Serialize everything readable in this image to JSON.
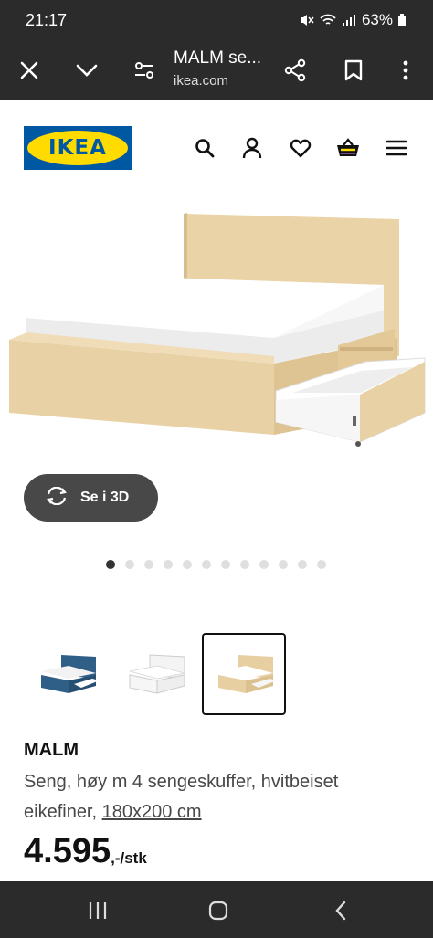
{
  "status_bar": {
    "time": "21:17",
    "battery": "63%"
  },
  "browser": {
    "title": "MALM se...",
    "url": "ikea.com",
    "icons": [
      "close-icon",
      "chevron-down-icon",
      "page-controls-icon",
      "share-icon",
      "bookmark-icon",
      "more-icon"
    ]
  },
  "header": {
    "logo": "IKEA",
    "icons": [
      "search-icon",
      "account-icon",
      "wishlist-heart-icon",
      "shopping-basket-icon",
      "menu-icon"
    ]
  },
  "hero": {
    "view_3d_label": "Se i 3D",
    "dots_total": 12,
    "dots_active_index": 0
  },
  "variants": [
    {
      "name": "blue",
      "color": "#2f5f86",
      "selected": false
    },
    {
      "name": "white",
      "color": "#f2f2f2",
      "selected": false
    },
    {
      "name": "oak",
      "color": "#e7cfa2",
      "selected": true
    }
  ],
  "product": {
    "name": "MALM",
    "description": "Seng, høy m 4 sengeskuffer, hvitbeiset eikefiner,",
    "size": "180x200 cm",
    "price": "4.595",
    "price_suffix": ",-/stk"
  },
  "colors": {
    "ikea_blue": "#0058a3",
    "ikea_yellow": "#ffdb00",
    "dark_bar": "#2b2b2b",
    "wood": "#e8d1a5"
  }
}
